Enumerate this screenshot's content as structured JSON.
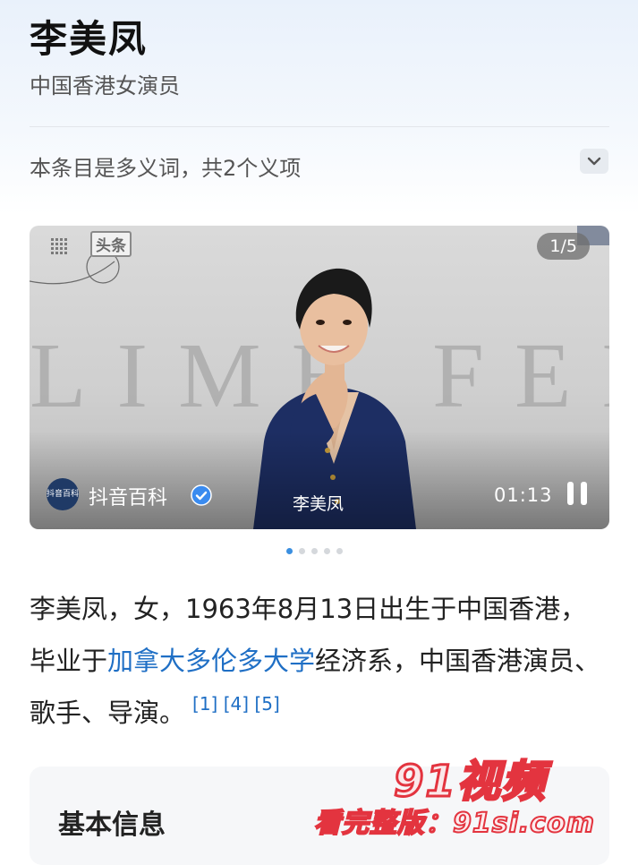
{
  "entry": {
    "title": "李美凤",
    "subtitle": "中国香港女演员",
    "polysemy_note": "本条目是多义词，共2个义项"
  },
  "media": {
    "badge": "头条",
    "counter": "1/5",
    "background_word": "LIME FENG",
    "caption": "李美凤",
    "source_logo": "抖音百科",
    "source_name": "抖音百科",
    "duration": "01:13",
    "slide_count": 5,
    "active_slide": 1,
    "icons": [
      "grid-icon",
      "verified-icon",
      "pause-icon"
    ]
  },
  "intro": {
    "part1": "李美凤，女，1963年8月13日出生于中国香港，毕业于",
    "link": "加拿大多伦多大学",
    "part2": "经济系，中国香港演员、歌手、导演。",
    "refs": [
      "[1]",
      "[4]",
      "[5]"
    ]
  },
  "basic_info": {
    "title": "基本信息"
  },
  "watermark": {
    "line1": "91视频",
    "line2": "看完整版：91si.com"
  },
  "colors": {
    "link": "#1f6fc5",
    "dot_active": "#3b8fe0",
    "watermark": "#e3343f"
  }
}
